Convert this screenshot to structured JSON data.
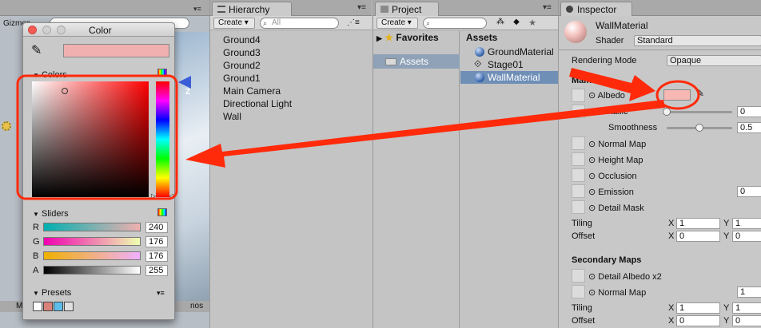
{
  "scene": {
    "gizmos_label": "Gizmos",
    "bottom_left": "M",
    "bottom_right": "nos",
    "axis_z": "Z"
  },
  "hierarchy": {
    "tab_label": "Hierarchy",
    "create_label": "Create",
    "search_placeholder": "All",
    "items": [
      "Ground4",
      "Ground3",
      "Ground2",
      "Ground1",
      "Main Camera",
      "Directional Light",
      "Wall"
    ]
  },
  "project": {
    "tab_label": "Project",
    "create_label": "Create",
    "favorites_label": "Favorites",
    "assets_label": "Assets",
    "assets_header": "Assets",
    "assets": [
      "GroundMaterial",
      "Stage01",
      "WallMaterial"
    ]
  },
  "inspector": {
    "tab_label": "Inspector",
    "material_name": "WallMaterial",
    "shader_label": "Shader",
    "shader_value": "Standard",
    "rendering_mode_label": "Rendering Mode",
    "rendering_mode_value": "Opaque",
    "main_header": "Main",
    "albedo_label": "Albedo",
    "albedo_color": "#f7b8b3",
    "metallic_label": "Metallic",
    "metallic_value": "0",
    "metallic_level": 0,
    "smoothness_label": "Smoothness",
    "smoothness_value": "0.5",
    "smoothness_level": 0.5,
    "normal_map_label": "Normal Map",
    "height_map_label": "Height Map",
    "occlusion_label": "Occlusion",
    "emission_label": "Emission",
    "emission_value": "0",
    "detail_mask_label": "Detail Mask",
    "tiling_label": "Tiling",
    "offset_label": "Offset",
    "x_label": "X",
    "y_label": "Y",
    "tiling_x": "1",
    "tiling_y": "1",
    "offset_x": "0",
    "offset_y": "0",
    "secondary_header": "Secondary Maps",
    "detail_albedo_label": "Detail Albedo x2",
    "sec_normal_map_label": "Normal Map",
    "sec_normal_value": "1",
    "sec_tiling_x": "1",
    "sec_tiling_y": "1",
    "sec_offset_x": "0",
    "sec_offset_y": "0"
  },
  "color_picker": {
    "title": "Color",
    "current_color": "#f0b0b0",
    "colors_label": "Colors",
    "sliders_label": "Sliders",
    "r_label": "R",
    "r_value": "240",
    "g_label": "G",
    "g_value": "176",
    "b_label": "B",
    "b_value": "176",
    "a_label": "A",
    "a_value": "255",
    "presets_label": "Presets",
    "preset_colors": [
      "#ffffff",
      "#d9827a",
      "#5bbde8",
      "#e0e0e0"
    ]
  },
  "annotation": {
    "color": "#ff2a0a"
  }
}
